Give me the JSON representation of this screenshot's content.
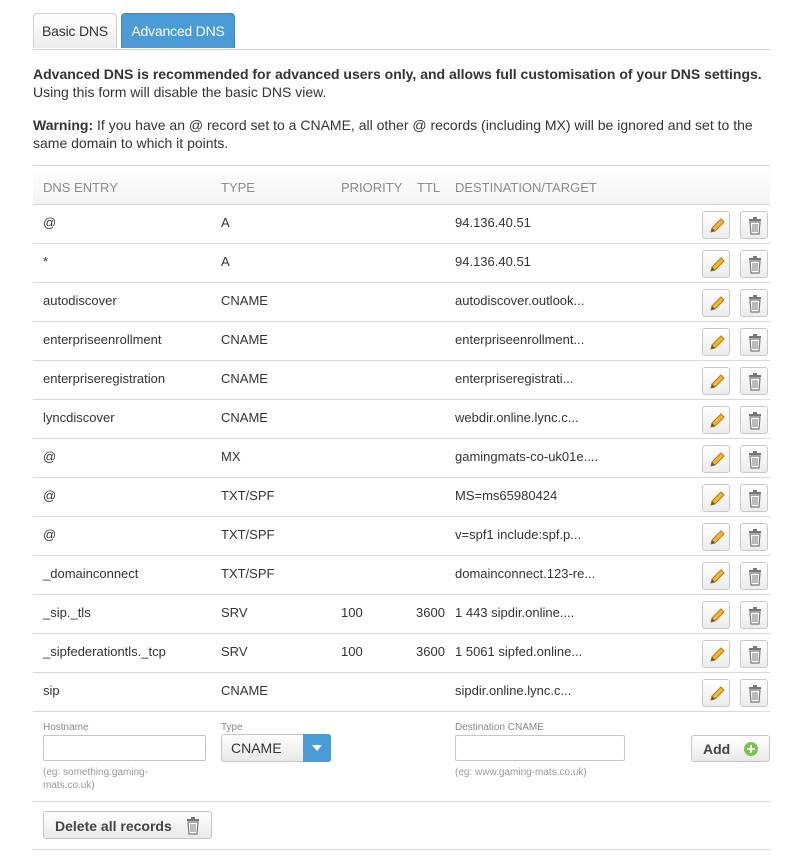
{
  "tabs": {
    "basic": "Basic DNS",
    "advanced": "Advanced DNS"
  },
  "intro": {
    "bold": "Advanced DNS is recommended for advanced users only, and allows full customisation of your DNS settings.",
    "normal": "Using this form will disable the basic DNS view.",
    "warning_label": "Warning:",
    "warning_text": " If you have an @ record set to a CNAME, all other @ records (including MX) will be ignored and set to the same domain to which it points."
  },
  "table": {
    "headers": {
      "entry": "DNS ENTRY",
      "type": "TYPE",
      "priority": "PRIORITY",
      "ttl": "TTL",
      "target": "DESTINATION/TARGET"
    },
    "rows": [
      {
        "entry": "@",
        "type": "A",
        "priority": "",
        "ttl": "",
        "target": "94.136.40.51"
      },
      {
        "entry": "*",
        "type": "A",
        "priority": "",
        "ttl": "",
        "target": "94.136.40.51"
      },
      {
        "entry": "autodiscover",
        "type": "CNAME",
        "priority": "",
        "ttl": "",
        "target": "autodiscover.outlook..."
      },
      {
        "entry": "enterpriseenrollment",
        "type": "CNAME",
        "priority": "",
        "ttl": "",
        "target": "enterpriseenrollment..."
      },
      {
        "entry": "enterpriseregistration",
        "type": "CNAME",
        "priority": "",
        "ttl": "",
        "target": "enterpriseregistrati..."
      },
      {
        "entry": "lyncdiscover",
        "type": "CNAME",
        "priority": "",
        "ttl": "",
        "target": "webdir.online.lync.c..."
      },
      {
        "entry": "@",
        "type": "MX",
        "priority": "",
        "ttl": "",
        "target": "gamingmats-co-uk01e...."
      },
      {
        "entry": "@",
        "type": "TXT/SPF",
        "priority": "",
        "ttl": "",
        "target": "MS=ms65980424"
      },
      {
        "entry": "@",
        "type": "TXT/SPF",
        "priority": "",
        "ttl": "",
        "target": "v=spf1 include:spf.p..."
      },
      {
        "entry": "_domainconnect",
        "type": "TXT/SPF",
        "priority": "",
        "ttl": "",
        "target": "domainconnect.123-re..."
      },
      {
        "entry": "_sip._tls",
        "type": "SRV",
        "priority": "100",
        "ttl": "3600",
        "target": "1 443 sipdir.online...."
      },
      {
        "entry": "_sipfederationtls._tcp",
        "type": "SRV",
        "priority": "100",
        "ttl": "3600",
        "target": "1 5061 sipfed.online..."
      },
      {
        "entry": "sip",
        "type": "CNAME",
        "priority": "",
        "ttl": "",
        "target": "sipdir.online.lync.c..."
      }
    ]
  },
  "form": {
    "hostname_label": "Hostname",
    "hostname_value": "",
    "hostname_hint": "(eg: something.gaming-mats.co.uk)",
    "type_label": "Type",
    "type_value": "CNAME",
    "dest_label": "Destination CNAME",
    "dest_value": "",
    "dest_hint": "(eg: www.gaming-mats.co.uk)",
    "add_label": "Add"
  },
  "delete_all_label": "Delete all records",
  "colors": {
    "accent": "#4a9bd6",
    "add_green": "#7cc24a",
    "pencil": "#e8a21a"
  },
  "icons": {
    "edit": "pencil-icon",
    "delete": "trash-icon",
    "add": "plus-icon",
    "dropdown": "chevron-down-icon"
  }
}
